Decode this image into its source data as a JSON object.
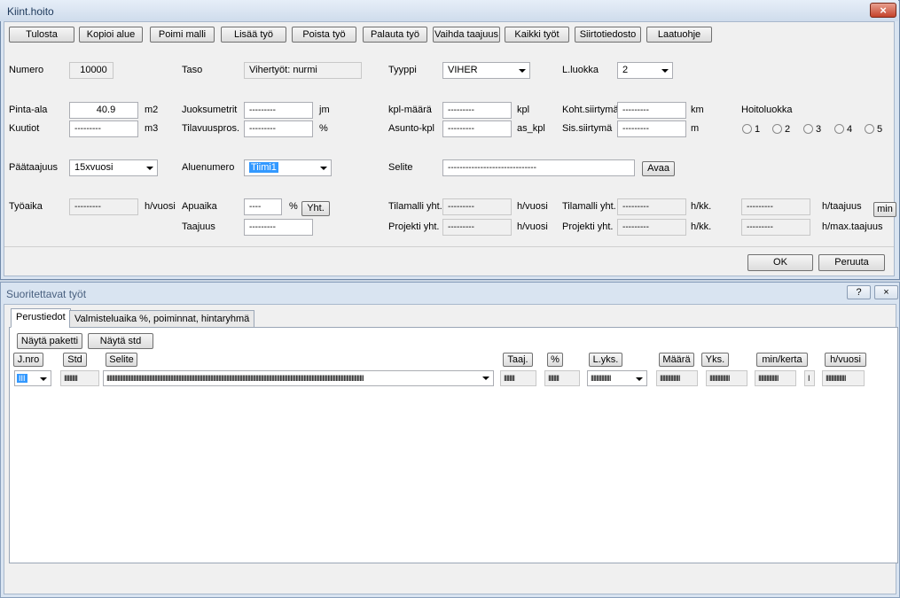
{
  "window1": {
    "title": "Kiint.hoito",
    "close": "×"
  },
  "toolbar": [
    {
      "label": "Tulosta"
    },
    {
      "label": "Kopioi alue"
    },
    {
      "label": "Poimi malli"
    },
    {
      "label": "Lisää työ"
    },
    {
      "label": "Poista työ"
    },
    {
      "label": "Palauta työ"
    },
    {
      "label": "Vaihda taajuus"
    },
    {
      "label": "Kaikki työt"
    },
    {
      "label": "Siirtotiedosto"
    },
    {
      "label": "Laatuohje"
    }
  ],
  "form": {
    "numero_label": "Numero",
    "numero_value": "10000",
    "taso_label": "Taso",
    "taso_value": "Vihertyöt: nurmi",
    "tyyppi_label": "Tyyppi",
    "tyyppi_value": "VIHER",
    "lluokka_label": "L.luokka",
    "lluokka_value": "2",
    "pintaala_label": "Pinta-ala",
    "pintaala_value": "40.9",
    "pintaala_unit": "m2",
    "kuutiot_label": "Kuutiot",
    "kuutiot_value": "---------",
    "kuutiot_unit": "m3",
    "juoksumetrit_label": "Juoksumetrit",
    "juoksumetrit_value": "---------",
    "juoksumetrit_unit": "jm",
    "tilavuuspros_label": "Tilavuuspros.",
    "tilavuuspros_value": "---------",
    "tilavuuspros_unit": "%",
    "kplmaara_label": "kpl-määrä",
    "kplmaara_value": "---------",
    "kplmaara_unit": "kpl",
    "asuntokpl_label": "Asunto-kpl",
    "asuntokpl_value": "---------",
    "asuntokpl_unit": "as_kpl",
    "kohtsiirtyma_label": "Koht.siirtymä",
    "kohtsiirtyma_value": "---------",
    "kohtsiirtyma_unit": "km",
    "sissiirtyma_label": "Sis.siirtymä",
    "sissiirtyma_value": "---------",
    "sissiirtyma_unit": "m",
    "hoitoluokka_label": "Hoitoluokka",
    "hoitoluokka_options": [
      "1",
      "2",
      "3",
      "4",
      "5"
    ],
    "paataajuus_label": "Päätaajuus",
    "paataajuus_value": "15xvuosi",
    "aluenumero_label": "Aluenumero",
    "aluenumero_value": "Tiimi1",
    "selite_label": "Selite",
    "selite_value": "------------------------------",
    "avaa": "Avaa",
    "tyoaika_label": "Työaika",
    "tyoaika_value": "---------",
    "tyoaika_unit": "h/vuosi",
    "apuaika_label": "Apuaika",
    "apuaika_value": "----",
    "apuaika_unit": "%",
    "yht": "Yht.",
    "taajuus_label": "Taajuus",
    "taajuus_value": "---------",
    "tilamalli_label": "Tilamalli yht.",
    "tilamalli_value": "---------",
    "tilamalli_unit": "h/vuosi",
    "projekti_label": "Projekti yht.",
    "projekti_value": "---------",
    "projekti_unit": "h/vuosi",
    "tilamalli2_label": "Tilamalli yht.",
    "tilamalli2_value": "---------",
    "tilamalli2_unit": "h/kk.",
    "projekti2_label": "Projekti yht.",
    "projekti2_value": "---------",
    "projekti2_unit": "h/kk.",
    "col5a_value": "---------",
    "col5a_unit": "h/taajuus",
    "min": "min",
    "col5b_value": "---------",
    "col5b_unit": "h/max.taajuus"
  },
  "dialog": {
    "ok": "OK",
    "cancel": "Peruuta"
  },
  "window2": {
    "title": "Suoritettavat työt",
    "help": "?",
    "close": "×"
  },
  "tabs": [
    {
      "label": "Perustiedot"
    },
    {
      "label": "Valmisteluaika %, poiminnat, hintaryhmä"
    }
  ],
  "panel": {
    "nayta_paketti": "Näytä paketti",
    "nayta_std": "Näytä std"
  },
  "columns": {
    "jnro": "J.nro",
    "std": "Std",
    "selite": "Selite",
    "taaj": "Taaj.",
    "pct": "%",
    "lyks": "L.yks.",
    "maara": "Määrä",
    "yks": "Yks.",
    "minkerta": "min/kerta",
    "hvuosi": "h/vuosi"
  },
  "row": {
    "jnro": "III",
    "std": "IIIIIIIIII",
    "selite": "IIIIIIIIIIIIIIIIIIIIIIIIIIIIIIIIIIIIIIIIIIIIIIIIIIIIIIIIIIIIIIIIIIIIIIIIIIIIIIIIIIIIIIIIIIIIIIIIIIIIIIIIIIIIIIIIIIIIIIIIIIIIIIIIIIIIIIIIIIIIIIIIIIIIIIIIIIIIIIIIIIIIIIIIIIIIIIIIIIIIIIIIIIIIIIIII",
    "taaj": "IIIIIIII",
    "pct": "IIIIIIII",
    "lyks": "IIIIIIIIIIIIIII",
    "maara": "IIIIIIIIIIIIIII",
    "yks": "IIIIIIIIIIIIIII",
    "minkerta": "IIIIIIIIIIIIIII",
    "extra": "I",
    "hvuosi": "IIIIIIIIIIIIIII"
  }
}
